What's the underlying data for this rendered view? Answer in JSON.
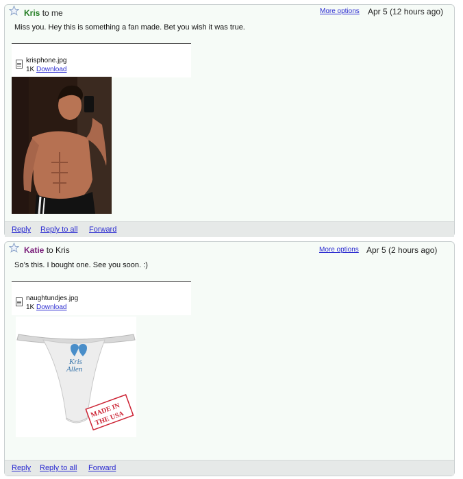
{
  "messages": [
    {
      "sender": "Kris",
      "recipient_text": "to me",
      "more_options": "More options",
      "date": "Apr 5 (12 hours ago)",
      "body": "Miss you. Hey this is something a fan made. Bet you wish it was true.",
      "attachment": {
        "filename": "krisphone.jpg",
        "size": "1K",
        "download": "Download"
      },
      "actions": {
        "reply": "Reply",
        "reply_all": "Reply to all",
        "forward": "Forward"
      }
    },
    {
      "sender": "Katie",
      "recipient_text": "to Kris",
      "more_options": "More options",
      "date": "Apr 5 (2 hours ago)",
      "body": "So’s this. I bought one. See you soon. :)",
      "attachment": {
        "filename": "naughtundjes.jpg",
        "size": "1K",
        "download": "Download"
      },
      "image_text": {
        "brand_line1": "Kris",
        "brand_line2": "Allen",
        "stamp_line1": "MADE IN",
        "stamp_line2": "THE USA"
      },
      "actions": {
        "reply": "Reply",
        "reply_all": "Reply to all",
        "forward": "Forward"
      }
    }
  ],
  "colors": {
    "kris_name": "#1e7a1e",
    "katie_name": "#7a1e7a",
    "link": "#2a2ad0",
    "panel_bg": "#f6fbf7",
    "action_bar": "#e6e9e8"
  },
  "icons": {
    "star": "star-icon",
    "file": "file-icon"
  }
}
